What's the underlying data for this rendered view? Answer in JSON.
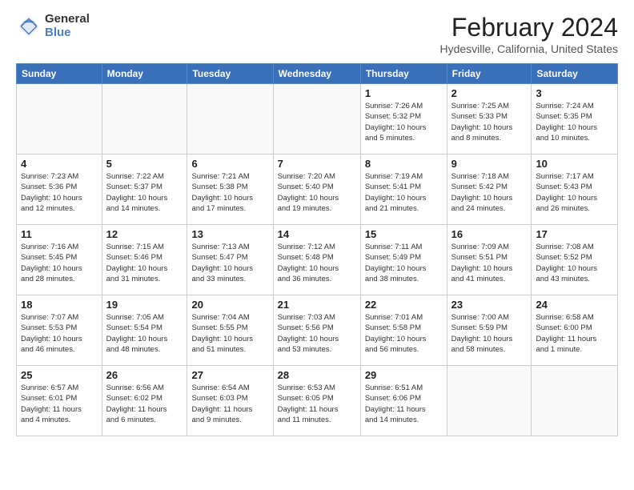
{
  "logo": {
    "general": "General",
    "blue": "Blue"
  },
  "header": {
    "month": "February 2024",
    "location": "Hydesville, California, United States"
  },
  "days_of_week": [
    "Sunday",
    "Monday",
    "Tuesday",
    "Wednesday",
    "Thursday",
    "Friday",
    "Saturday"
  ],
  "weeks": [
    [
      {
        "day": "",
        "info": ""
      },
      {
        "day": "",
        "info": ""
      },
      {
        "day": "",
        "info": ""
      },
      {
        "day": "",
        "info": ""
      },
      {
        "day": "1",
        "info": "Sunrise: 7:26 AM\nSunset: 5:32 PM\nDaylight: 10 hours\nand 5 minutes."
      },
      {
        "day": "2",
        "info": "Sunrise: 7:25 AM\nSunset: 5:33 PM\nDaylight: 10 hours\nand 8 minutes."
      },
      {
        "day": "3",
        "info": "Sunrise: 7:24 AM\nSunset: 5:35 PM\nDaylight: 10 hours\nand 10 minutes."
      }
    ],
    [
      {
        "day": "4",
        "info": "Sunrise: 7:23 AM\nSunset: 5:36 PM\nDaylight: 10 hours\nand 12 minutes."
      },
      {
        "day": "5",
        "info": "Sunrise: 7:22 AM\nSunset: 5:37 PM\nDaylight: 10 hours\nand 14 minutes."
      },
      {
        "day": "6",
        "info": "Sunrise: 7:21 AM\nSunset: 5:38 PM\nDaylight: 10 hours\nand 17 minutes."
      },
      {
        "day": "7",
        "info": "Sunrise: 7:20 AM\nSunset: 5:40 PM\nDaylight: 10 hours\nand 19 minutes."
      },
      {
        "day": "8",
        "info": "Sunrise: 7:19 AM\nSunset: 5:41 PM\nDaylight: 10 hours\nand 21 minutes."
      },
      {
        "day": "9",
        "info": "Sunrise: 7:18 AM\nSunset: 5:42 PM\nDaylight: 10 hours\nand 24 minutes."
      },
      {
        "day": "10",
        "info": "Sunrise: 7:17 AM\nSunset: 5:43 PM\nDaylight: 10 hours\nand 26 minutes."
      }
    ],
    [
      {
        "day": "11",
        "info": "Sunrise: 7:16 AM\nSunset: 5:45 PM\nDaylight: 10 hours\nand 28 minutes."
      },
      {
        "day": "12",
        "info": "Sunrise: 7:15 AM\nSunset: 5:46 PM\nDaylight: 10 hours\nand 31 minutes."
      },
      {
        "day": "13",
        "info": "Sunrise: 7:13 AM\nSunset: 5:47 PM\nDaylight: 10 hours\nand 33 minutes."
      },
      {
        "day": "14",
        "info": "Sunrise: 7:12 AM\nSunset: 5:48 PM\nDaylight: 10 hours\nand 36 minutes."
      },
      {
        "day": "15",
        "info": "Sunrise: 7:11 AM\nSunset: 5:49 PM\nDaylight: 10 hours\nand 38 minutes."
      },
      {
        "day": "16",
        "info": "Sunrise: 7:09 AM\nSunset: 5:51 PM\nDaylight: 10 hours\nand 41 minutes."
      },
      {
        "day": "17",
        "info": "Sunrise: 7:08 AM\nSunset: 5:52 PM\nDaylight: 10 hours\nand 43 minutes."
      }
    ],
    [
      {
        "day": "18",
        "info": "Sunrise: 7:07 AM\nSunset: 5:53 PM\nDaylight: 10 hours\nand 46 minutes."
      },
      {
        "day": "19",
        "info": "Sunrise: 7:05 AM\nSunset: 5:54 PM\nDaylight: 10 hours\nand 48 minutes."
      },
      {
        "day": "20",
        "info": "Sunrise: 7:04 AM\nSunset: 5:55 PM\nDaylight: 10 hours\nand 51 minutes."
      },
      {
        "day": "21",
        "info": "Sunrise: 7:03 AM\nSunset: 5:56 PM\nDaylight: 10 hours\nand 53 minutes."
      },
      {
        "day": "22",
        "info": "Sunrise: 7:01 AM\nSunset: 5:58 PM\nDaylight: 10 hours\nand 56 minutes."
      },
      {
        "day": "23",
        "info": "Sunrise: 7:00 AM\nSunset: 5:59 PM\nDaylight: 10 hours\nand 58 minutes."
      },
      {
        "day": "24",
        "info": "Sunrise: 6:58 AM\nSunset: 6:00 PM\nDaylight: 11 hours\nand 1 minute."
      }
    ],
    [
      {
        "day": "25",
        "info": "Sunrise: 6:57 AM\nSunset: 6:01 PM\nDaylight: 11 hours\nand 4 minutes."
      },
      {
        "day": "26",
        "info": "Sunrise: 6:56 AM\nSunset: 6:02 PM\nDaylight: 11 hours\nand 6 minutes."
      },
      {
        "day": "27",
        "info": "Sunrise: 6:54 AM\nSunset: 6:03 PM\nDaylight: 11 hours\nand 9 minutes."
      },
      {
        "day": "28",
        "info": "Sunrise: 6:53 AM\nSunset: 6:05 PM\nDaylight: 11 hours\nand 11 minutes."
      },
      {
        "day": "29",
        "info": "Sunrise: 6:51 AM\nSunset: 6:06 PM\nDaylight: 11 hours\nand 14 minutes."
      },
      {
        "day": "",
        "info": ""
      },
      {
        "day": "",
        "info": ""
      }
    ]
  ]
}
